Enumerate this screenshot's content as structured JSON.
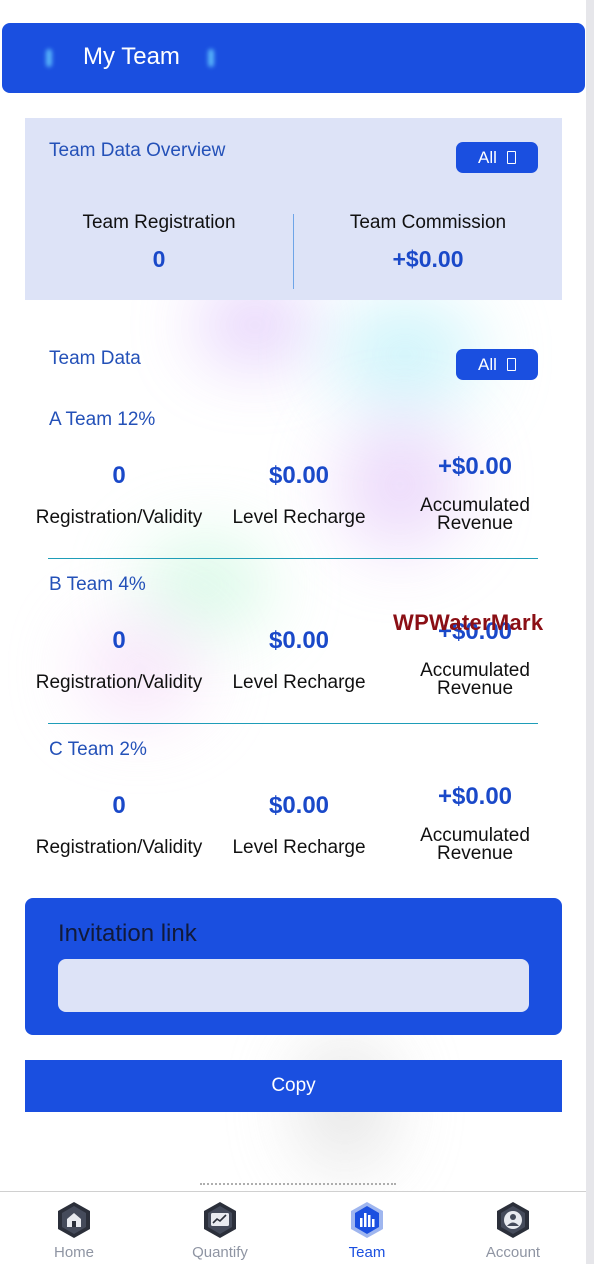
{
  "header": {
    "title": "My Team"
  },
  "overview": {
    "title": "Team Data Overview",
    "filter_label": "All",
    "registration_label": "Team Registration",
    "registration_value": "0",
    "commission_label": "Team Commission",
    "commission_value": "+$0.00"
  },
  "team_data": {
    "title": "Team Data",
    "filter_label": "All",
    "teams": [
      {
        "name": "A Team 12%",
        "registration_value": "0",
        "registration_label": "Registration/Validity",
        "recharge_value": "$0.00",
        "recharge_label": "Level Recharge",
        "revenue_value": "+$0.00",
        "revenue_label_1": "Accumulated",
        "revenue_label_2": "Revenue"
      },
      {
        "name": "B Team 4%",
        "registration_value": "0",
        "registration_label": "Registration/Validity",
        "recharge_value": "$0.00",
        "recharge_label": "Level Recharge",
        "revenue_value": "+$0.00",
        "revenue_label_1": "Accumulated",
        "revenue_label_2": "Revenue"
      },
      {
        "name": "C Team 2%",
        "registration_value": "0",
        "registration_label": "Registration/Validity",
        "recharge_value": "$0.00",
        "recharge_label": "Level Recharge",
        "revenue_value": "+$0.00",
        "revenue_label_1": "Accumulated",
        "revenue_label_2": "Revenue"
      }
    ]
  },
  "watermark": "WPWaterMark",
  "invitation": {
    "title": "Invitation link",
    "link_value": ""
  },
  "copy_button": "Copy",
  "tabbar": {
    "items": [
      {
        "label": "Home",
        "icon": "home-icon"
      },
      {
        "label": "Quantify",
        "icon": "chart-icon"
      },
      {
        "label": "Team",
        "icon": "team-icon"
      },
      {
        "label": "Account",
        "icon": "account-icon"
      }
    ],
    "active": "Team"
  },
  "colors": {
    "primary": "#1a4fe0",
    "panel": "#dde3f7",
    "accent_text": "#2451b8",
    "value_text": "#1a49c9",
    "watermark": "#8b0f15"
  }
}
